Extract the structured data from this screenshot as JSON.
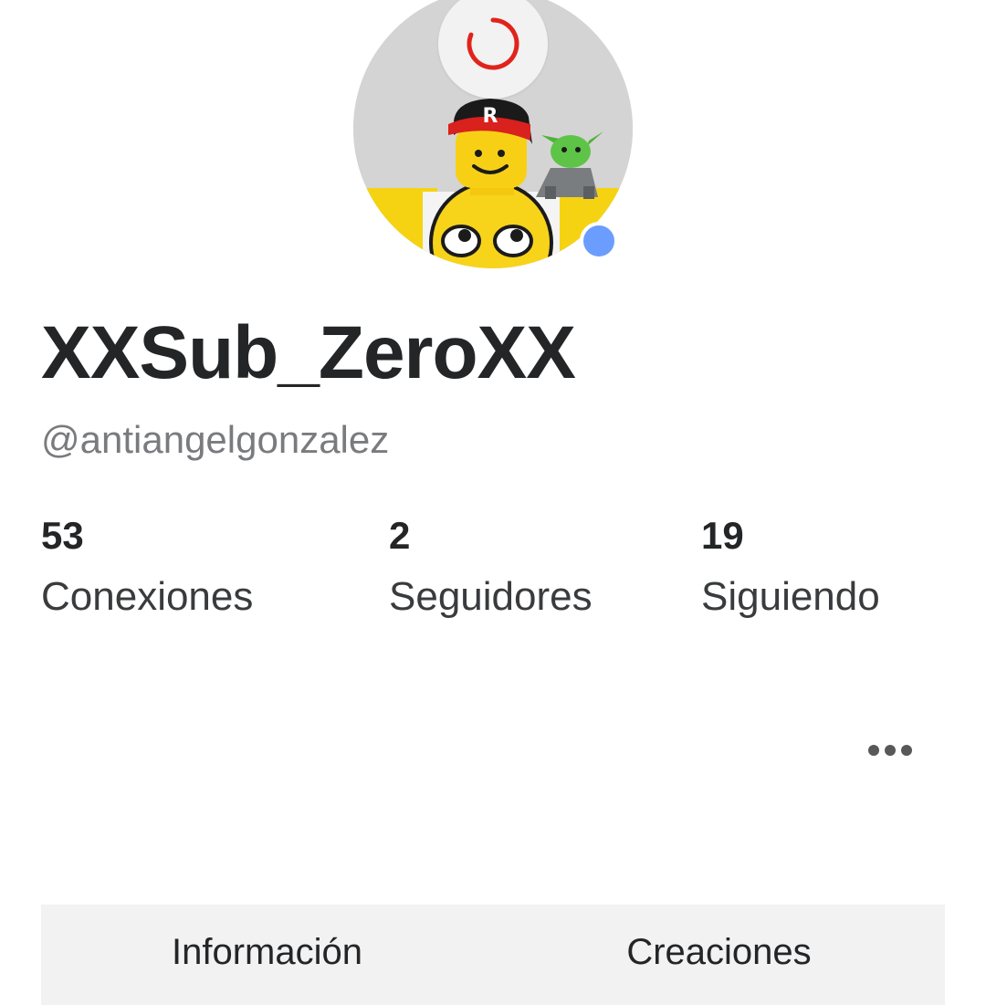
{
  "profile": {
    "display_name": "XXSub_ZeroXX",
    "username": "@antiangelgonzalez",
    "avatar_icon": "roblox-avatar-image",
    "loading_icon": "loading-spinner-icon",
    "online_status_color": "#6b9dff"
  },
  "stats": [
    {
      "value": "53",
      "label": "Conexiones"
    },
    {
      "value": "2",
      "label": "Seguidores"
    },
    {
      "value": "19",
      "label": "Siguiendo"
    }
  ],
  "more_icon": "more-horizontal-icon",
  "tabs": [
    {
      "label": "Información"
    },
    {
      "label": "Creaciones"
    }
  ],
  "colors": {
    "spinner": "#e0241b",
    "text_primary": "#232527",
    "text_secondary": "#7a7b7e",
    "tab_background": "#f2f2f3"
  }
}
